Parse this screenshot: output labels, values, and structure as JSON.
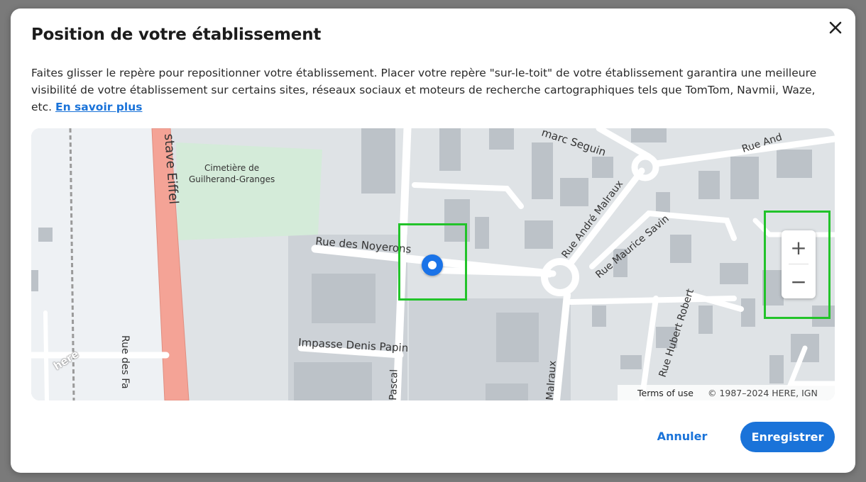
{
  "dialog": {
    "title": "Position de votre établissement",
    "description": "Faites glisser le repère pour repositionner votre établissement. Placer votre repère \"sur-le-toit\" de votre établissement garantira une meilleure visibilité de votre établissement sur certains sites, réseaux sociaux et moteurs de recherche cartographiques tels que TomTom, Navmii, Waze, etc.",
    "learn_more_link": "En savoir plus",
    "close_icon": "close-icon"
  },
  "map": {
    "street_labels": {
      "gustave_eiffel": "stave Eiffel",
      "cemetery_line1": "Cimetière de",
      "cemetery_line2": "Guilherand-Granges",
      "noyerons": "Rue des Noyerons",
      "denis_papin": "Impasse Denis Papin",
      "pascal": "Pascal",
      "malraux_bottom": "Malraux",
      "andre_malraux": "Rue André Malraux",
      "maurice_savin": "Rue Maurice Savin",
      "hubert_robert": "Rue Hubert Robert",
      "marc_seguin": "marc Seguin",
      "rue_and": "Rue And",
      "rue_des_fa": "Rue des Fa"
    },
    "map_logo": "here",
    "zoom_in_label": "+",
    "zoom_out_label": "−",
    "attribution": {
      "terms": "Terms of use",
      "copyright": "© 1987–2024 HERE, IGN"
    },
    "colors": {
      "pin": "#1a73e8",
      "highlight": "#22c32a",
      "main_road": "#f4a396",
      "park": "#d4ebd9"
    }
  },
  "footer": {
    "cancel_label": "Annuler",
    "save_label": "Enregistrer"
  }
}
